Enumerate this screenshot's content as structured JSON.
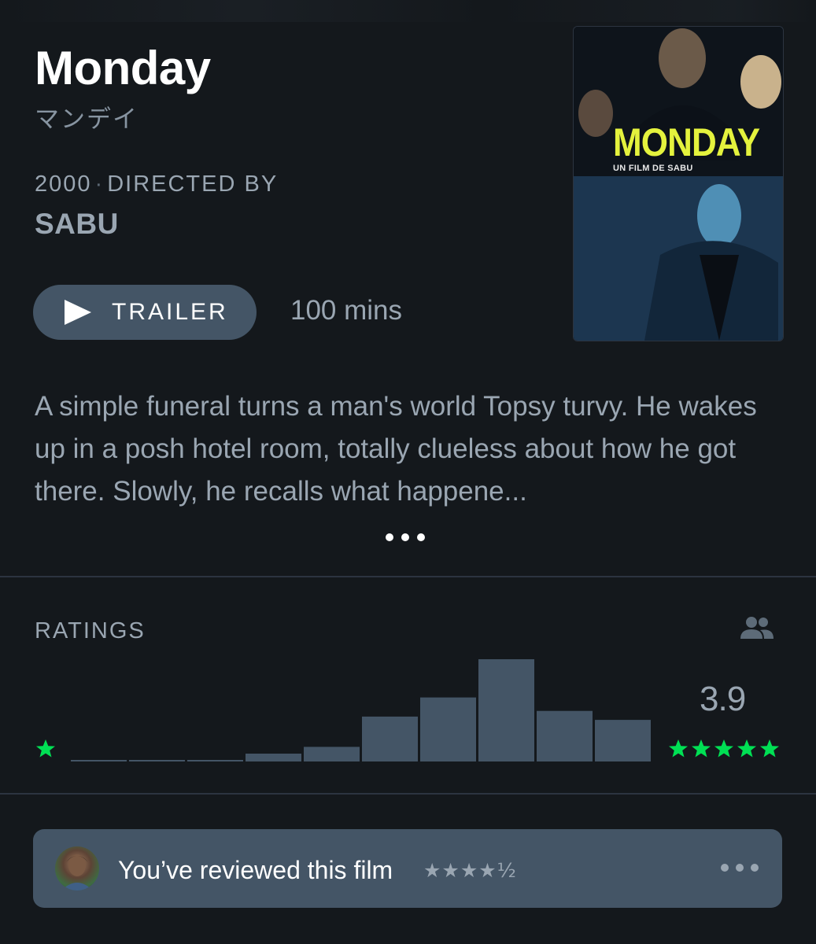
{
  "film": {
    "title": "Monday",
    "original_title": "マンデイ",
    "year": "2000",
    "directed_by_label": "DIRECTED BY",
    "director": "SABU",
    "runtime": "100 mins",
    "synopsis": "A simple funeral turns a man's world Topsy turvy. He wakes up in a posh hotel room, totally clueless about how he got there. Slowly, he recalls what happene..."
  },
  "trailer": {
    "label": "TRAILER",
    "icon": "play-icon"
  },
  "poster": {
    "title": "MONDAY",
    "credit": "UN FILM DE SABU",
    "accent": "#e4f23d"
  },
  "ratings": {
    "label": "RATINGS",
    "fans_icon": "people-icon",
    "average": "3.9",
    "low_star_icon": "star-icon",
    "high_stars_icon": "five-stars-icon",
    "star_color": "#00e054"
  },
  "chart_data": {
    "type": "bar",
    "categories": [
      "0.5",
      "1",
      "1.5",
      "2",
      "2.5",
      "3",
      "3.5",
      "4",
      "4.5",
      "5"
    ],
    "values": [
      1,
      1,
      1,
      7,
      13,
      40,
      57,
      91,
      45,
      37
    ],
    "title": "",
    "xlabel": "",
    "ylabel": "",
    "grid": false,
    "bar_color": "#445566"
  },
  "review": {
    "text": "You’ve reviewed this film",
    "stars": "★★★★½",
    "more_icon": "more-icon"
  },
  "colors": {
    "background": "#14181c",
    "button": "#445566",
    "text_muted": "#9aa6b2"
  }
}
